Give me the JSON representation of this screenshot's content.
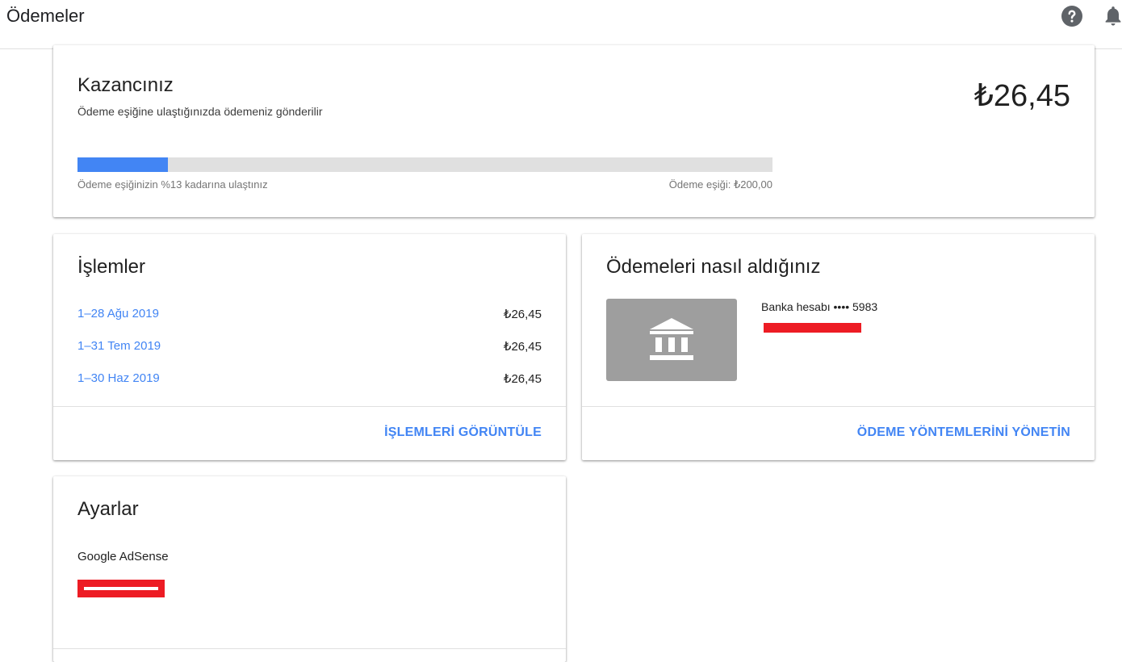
{
  "header": {
    "title": "Ödemeler",
    "icons": [
      "help-icon",
      "bell-icon"
    ]
  },
  "earnings": {
    "title": "Kazancınız",
    "subtitle": "Ödeme eşiğine ulaştığınızda ödemeniz gönderilir",
    "amount": "₺26,45",
    "progress_fraction": 0.13,
    "progress_label": "Ödeme eşiğinizin %13 kadarına ulaştınız",
    "threshold_label": "Ödeme eşiği: ₺200,00"
  },
  "transactions": {
    "title": "İşlemler",
    "rows": [
      {
        "period": "1–28 Ağu 2019",
        "amount": "₺26,45"
      },
      {
        "period": "1–31 Tem 2019",
        "amount": "₺26,45"
      },
      {
        "period": "1–30 Haz 2019",
        "amount": "₺26,45"
      }
    ],
    "action_label": "İŞLEMLERİ GÖRÜNTÜLE"
  },
  "payment_method": {
    "title": "Ödemeleri nasıl aldığınız",
    "bank_label": "Banka hesabı •••• 5983",
    "action_label": "ÖDEME YÖNTEMLERİNİ YÖNETİN",
    "icon": "bank-icon"
  },
  "settings": {
    "title": "Ayarlar",
    "product": "Google AdSense"
  },
  "colors": {
    "accent": "#4285f4",
    "progress_track": "#e0e0e0",
    "bank_tile": "#9e9e9e",
    "redaction": "#ed1c24"
  }
}
